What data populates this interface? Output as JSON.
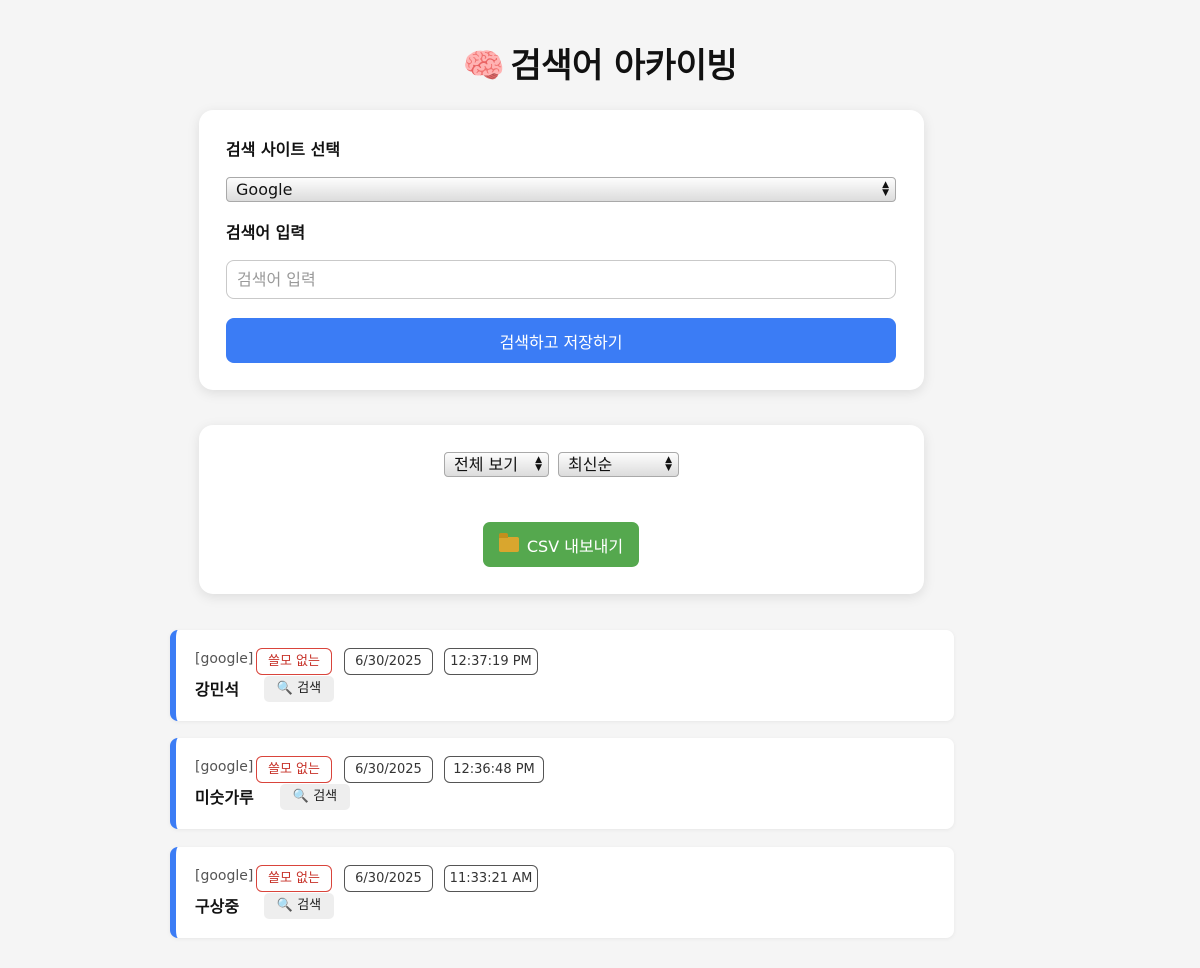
{
  "header": {
    "icon": "brain-icon",
    "emoji": "🧠",
    "title": "검색어 아카이빙"
  },
  "search_form": {
    "site_label": "검색 사이트 선택",
    "site_selected": "Google",
    "query_label": "검색어 입력",
    "query_value": "",
    "query_placeholder": "검색어 입력",
    "submit_label": "검색하고 저장하기"
  },
  "controls": {
    "filter_selected": "전체 보기",
    "sort_selected": "최신순",
    "csv_label": "CSV 내보내기",
    "csv_icon": "folder-icon"
  },
  "colors": {
    "accent": "#3b7cf5",
    "csv": "#55a84e",
    "tag_red": "#d9443b"
  },
  "entries": [
    {
      "site": "[google]",
      "tag": "쓸모 없는",
      "date": "6/30/2025",
      "time": "12:37:19 PM",
      "keyword": "강민석",
      "search_label": "🔍 검색"
    },
    {
      "site": "[google]",
      "tag": "쓸모 없는",
      "date": "6/30/2025",
      "time": "12:36:48 PM",
      "keyword": "미숫가루",
      "search_label": "🔍 검색"
    },
    {
      "site": "[google]",
      "tag": "쓸모 없는",
      "date": "6/30/2025",
      "time": "11:33:21 AM",
      "keyword": "구상중",
      "search_label": "🔍 검색"
    }
  ]
}
